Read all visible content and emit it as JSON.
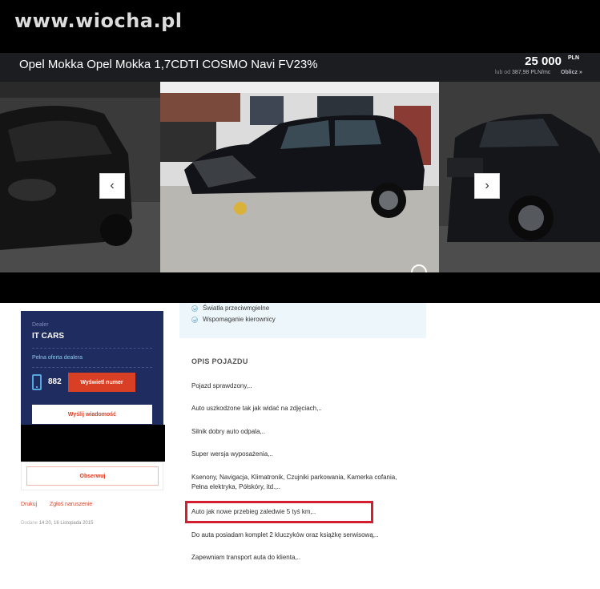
{
  "watermark": "www.wiocha.pl",
  "listing": {
    "title": "Opel Mokka Opel Mokka 1,7CDTI COSMO Navi FV23%",
    "price": "25 000",
    "currency": "PLN",
    "installment_prefix": "lub od",
    "installment_amount": "387,98 PLN/mc",
    "calculate": "Oblicz »"
  },
  "features": [
    "Światła przeciwmgielne",
    "Wspomaganie kierownicy"
  ],
  "dealer": {
    "label": "Dealer",
    "name": "IT CARS",
    "offer_link": "Pełna oferta dealera",
    "phone_partial": "882",
    "show_number_button": "Wyświetl numer",
    "send_message_button": "Wyślij wiadomość"
  },
  "actions": {
    "observe_button": "Obserwuj",
    "print_link": "Drukuj",
    "report_link": "Zgłoś naruszenie",
    "added_label": "Dodane",
    "added_date": "14:20, 16 Listopada 2015"
  },
  "description": {
    "heading": "OPIS POJAZDU",
    "lines": [
      "Pojazd sprawdzony,..",
      "Auto uszkodzone tak jak widać na zdjęciach,..",
      "Silnik dobry auto odpala,..",
      "Super wersja wyposażenia,..",
      "Ksenony, Navigacja, Klimatronik, Czujniki parkowania, Kamerka cofania, Pełna elektryka, Półskóry, itd.,..",
      "Auto jak nowe przebieg zaledwie 5 tyś km,..",
      "Do auta posiadam komplet 2 kluczyków oraz książkę serwisową,..",
      "Zapewniam transport auta do klienta,.."
    ]
  },
  "gallery": {
    "prev_icon": "chevron-left-icon",
    "next_icon": "chevron-right-icon",
    "zoom_icon": "zoom-icon"
  },
  "colors": {
    "accent": "#d93f24",
    "dealer_card": "#1f2c5f",
    "highlight": "#d21e2f"
  }
}
